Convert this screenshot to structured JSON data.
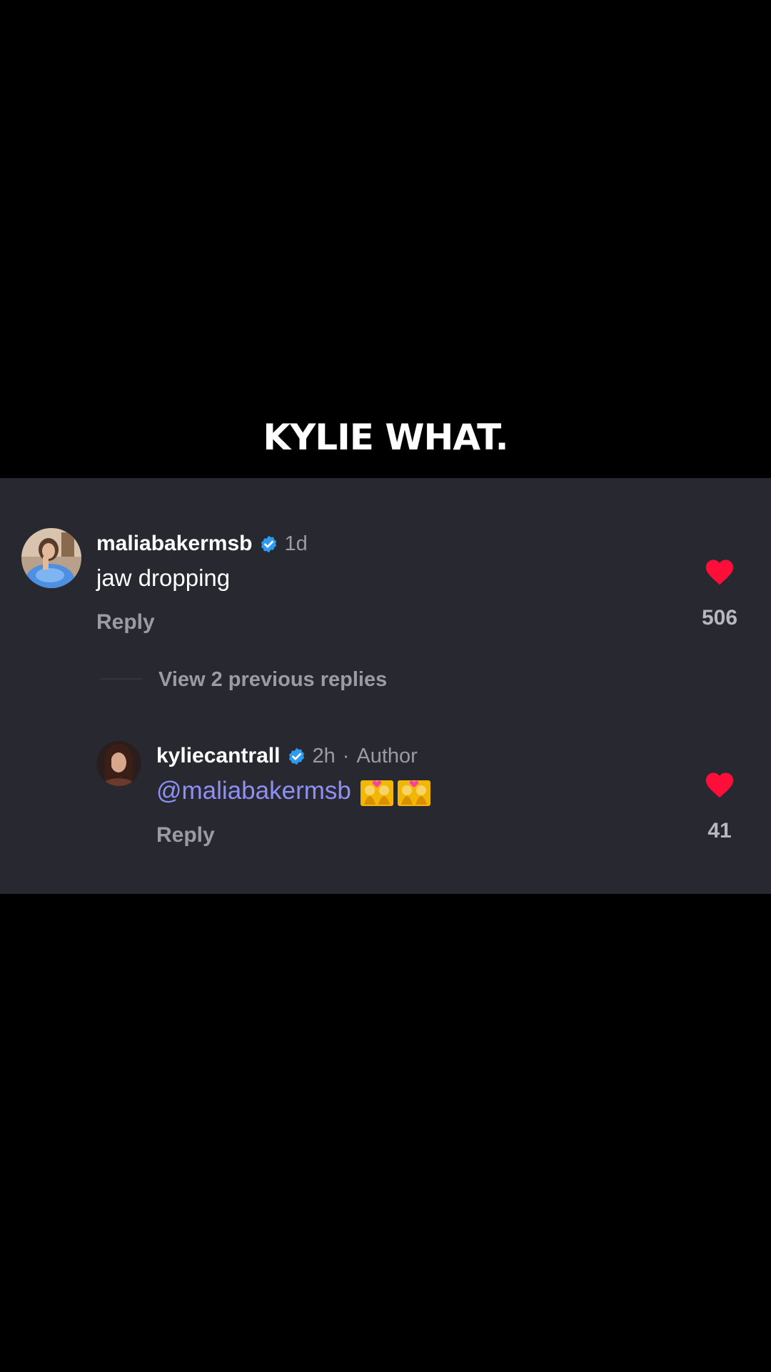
{
  "caption": "KYLIE WHAT.",
  "colors": {
    "panel_background": "#282930",
    "mention": "#8f8ff5",
    "verified_badge": "#2f9bf0",
    "like_heart": "#ff0e3a",
    "secondary_text": "#9b9ca3"
  },
  "comment": {
    "username": "maliabakermsb",
    "verified": true,
    "time": "1d",
    "text": "jaw dropping",
    "reply_label": "Reply",
    "liked": true,
    "like_count": "506",
    "avatar_icon": "user-avatar-photo"
  },
  "view_replies_label": "View 2 previous replies",
  "reply": {
    "username": "kyliecantrall",
    "verified": true,
    "time": "2h",
    "separator": "·",
    "author_tag": "Author",
    "mention": "@maliabakermsb",
    "emoji": [
      "couple-with-heart-emoji",
      "couple-with-heart-emoji"
    ],
    "reply_label": "Reply",
    "liked": true,
    "like_count": "41",
    "avatar_icon": "user-avatar-photo"
  }
}
